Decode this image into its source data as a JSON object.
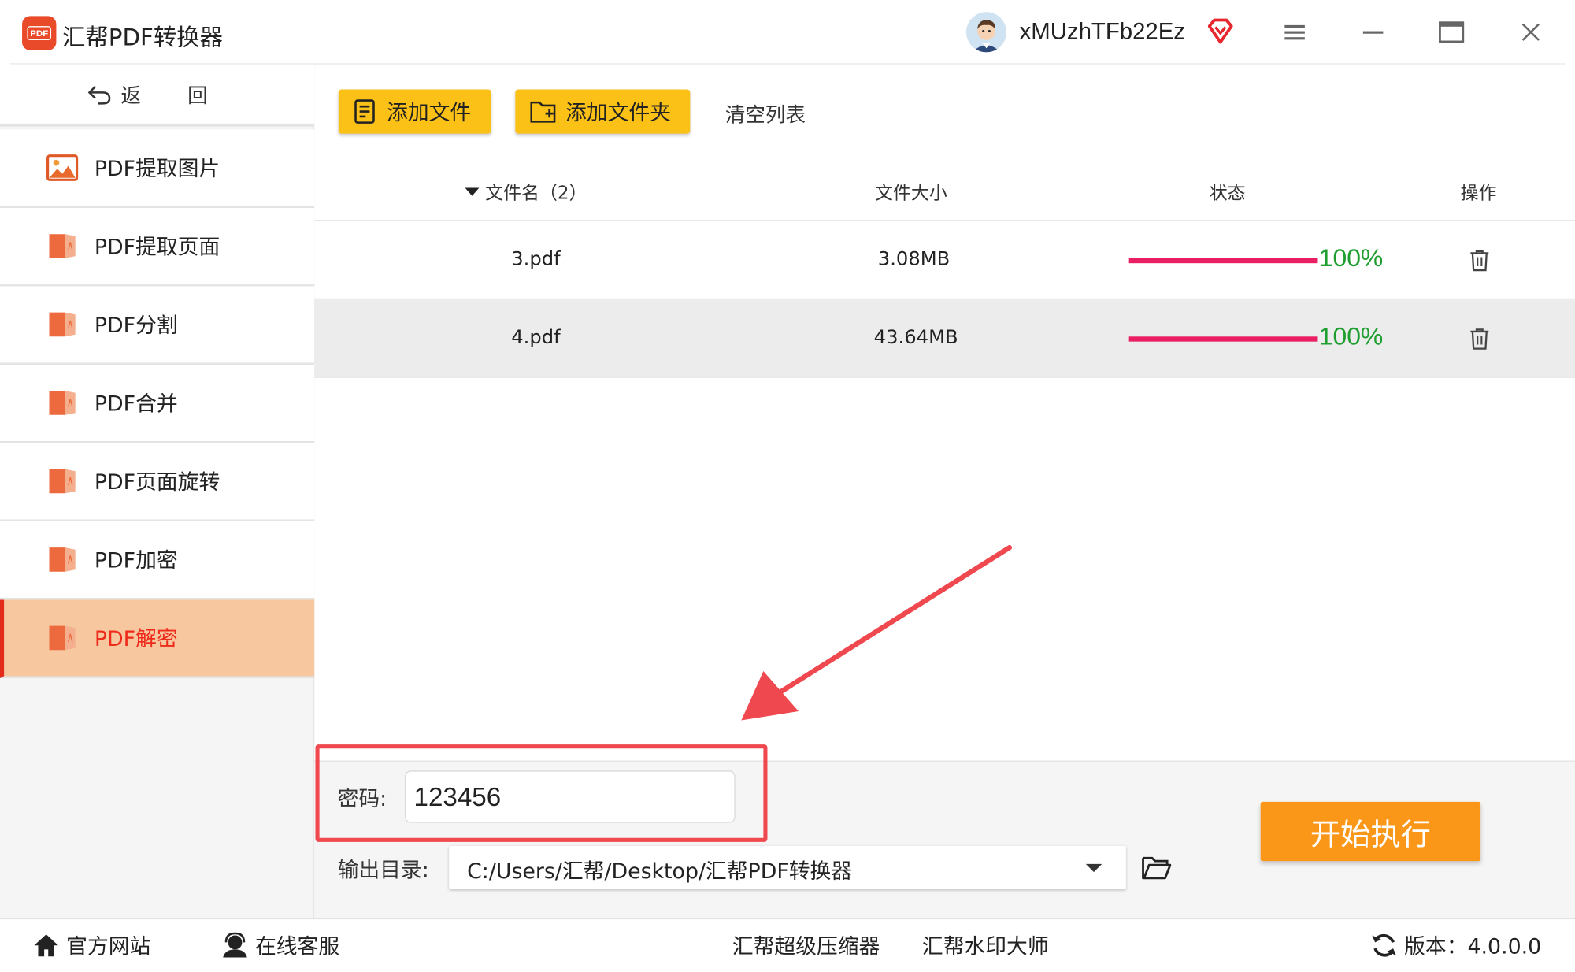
{
  "app": {
    "title": "汇帮PDF转换器",
    "logo_text": "PDF",
    "user_name": "xMUzhTFb22Ez"
  },
  "sidebar": {
    "back_label": "返 回",
    "items": [
      {
        "label": "PDF提取图片",
        "icon": "image-icon"
      },
      {
        "label": "PDF提取页面",
        "icon": "pdf-file-icon"
      },
      {
        "label": "PDF分割",
        "icon": "pdf-file-icon"
      },
      {
        "label": "PDF合并",
        "icon": "pdf-file-icon"
      },
      {
        "label": "PDF页面旋转",
        "icon": "pdf-file-icon"
      },
      {
        "label": "PDF加密",
        "icon": "pdf-file-icon"
      },
      {
        "label": "PDF解密",
        "icon": "pdf-file-icon",
        "active": true
      }
    ]
  },
  "toolbar": {
    "add_file": "添加文件",
    "add_folder": "添加文件夹",
    "clear_list": "清空列表"
  },
  "table": {
    "headers": {
      "name": "文件名（2）",
      "size": "文件大小",
      "status": "状态",
      "action": "操作"
    },
    "rows": [
      {
        "name": "3.pdf",
        "size": "3.08MB",
        "progress": "100%"
      },
      {
        "name": "4.pdf",
        "size": "43.64MB",
        "progress": "100%"
      }
    ]
  },
  "settings": {
    "password_label": "密码:",
    "password_value": "123456",
    "output_label": "输出目录:",
    "output_path": "C:/Users/汇帮/Desktop/汇帮PDF转换器",
    "start_button": "开始执行"
  },
  "footer": {
    "website": "官方网站",
    "support": "在线客服",
    "compressor": "汇帮超级压缩器",
    "watermark": "汇帮水印大师",
    "version": "版本：4.0.0.0"
  },
  "colors": {
    "accent_yellow": "#fcc116",
    "start_orange": "#fb9718",
    "active_bg": "#f7c7a0",
    "active_text": "#ee2b1b",
    "progress_bar": "#e91e63",
    "progress_text": "#1e9e2e",
    "highlight_red": "#f0484f"
  }
}
